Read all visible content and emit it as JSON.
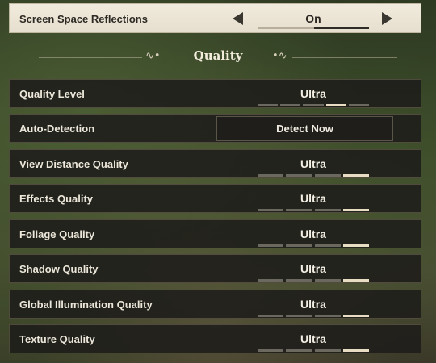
{
  "top_setting": {
    "label": "Screen Space Reflections",
    "value": "On",
    "toggle_position": 1
  },
  "section": {
    "title": "Quality"
  },
  "quality_level": {
    "label": "Quality Level",
    "value": "Ultra",
    "level": 4,
    "levels": 5
  },
  "auto_detection": {
    "label": "Auto-Detection",
    "button_label": "Detect Now"
  },
  "settings": [
    {
      "label": "View Distance Quality",
      "value": "Ultra",
      "level": 4,
      "levels": 4
    },
    {
      "label": "Effects Quality",
      "value": "Ultra",
      "level": 4,
      "levels": 4
    },
    {
      "label": "Foliage Quality",
      "value": "Ultra",
      "level": 4,
      "levels": 4
    },
    {
      "label": "Shadow Quality",
      "value": "Ultra",
      "level": 4,
      "levels": 4
    },
    {
      "label": "Global Illumination Quality",
      "value": "Ultra",
      "level": 4,
      "levels": 4
    },
    {
      "label": "Texture Quality",
      "value": "Ultra",
      "level": 4,
      "levels": 4
    }
  ],
  "colors": {
    "row_bg": "#1e1d1a",
    "row_border": "#786e5a",
    "highlight_bg": "#f1ebdd",
    "segment_active": "#e8dcc3",
    "segment_inactive": "#6b6860",
    "text": "#ece7da"
  },
  "icons": {
    "prev": "triangle-left-icon",
    "next": "triangle-right-icon"
  }
}
